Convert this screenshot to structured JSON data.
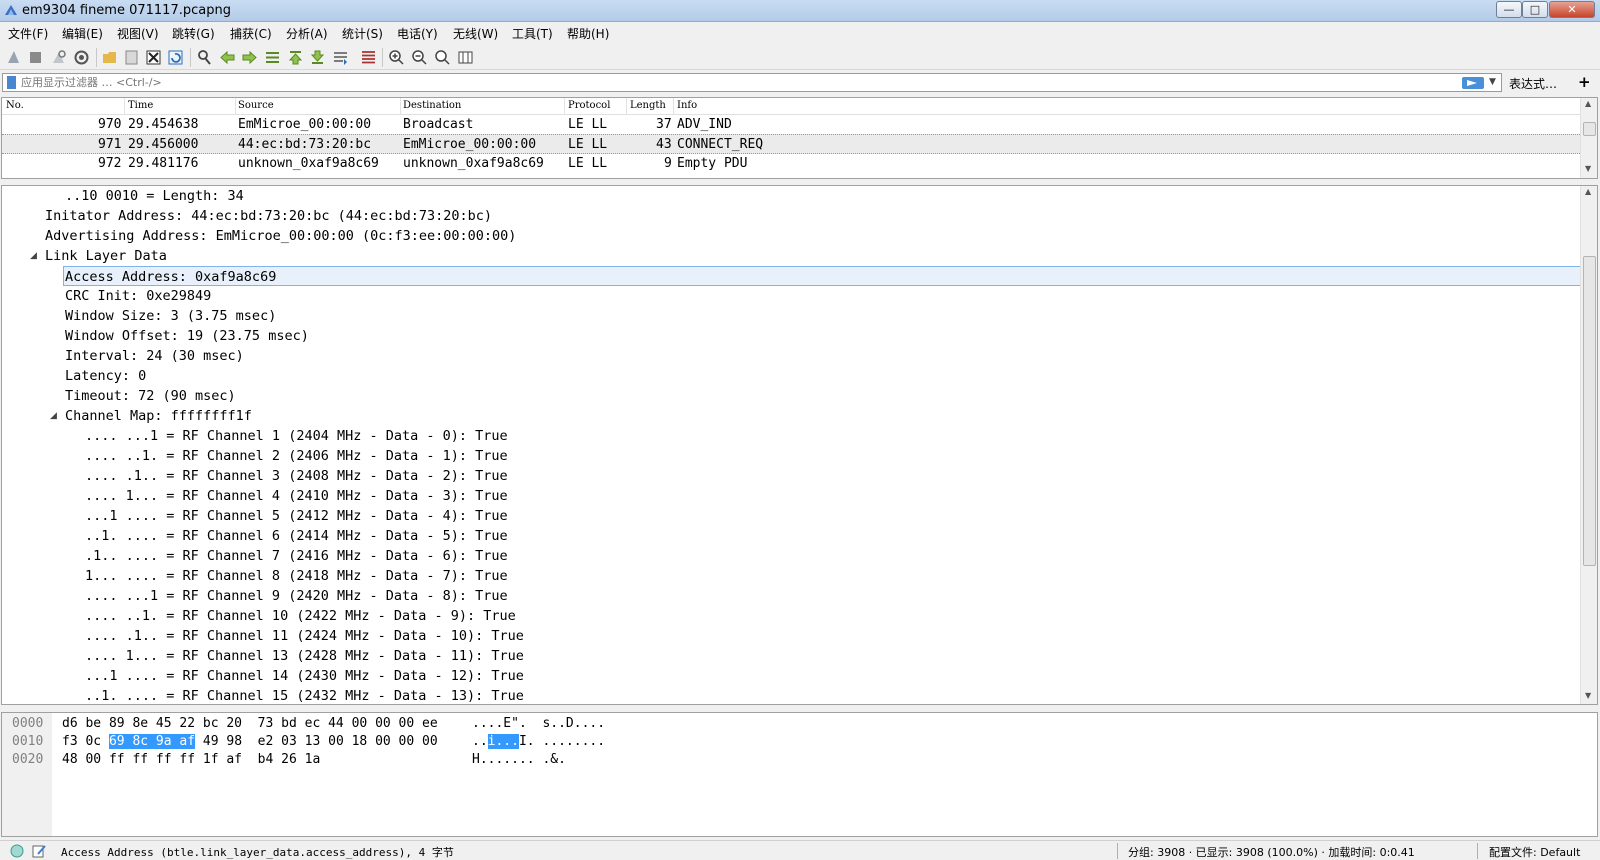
{
  "window": {
    "title": "em9304 fineme 071117.pcapng",
    "min_glyph": "—",
    "max_glyph": "□",
    "close_glyph": "✕"
  },
  "menu": [
    "文件(F)",
    "编辑(E)",
    "视图(V)",
    "跳转(G)",
    "捕获(C)",
    "分析(A)",
    "统计(S)",
    "电话(Y)",
    "无线(W)",
    "工具(T)",
    "帮助(H)"
  ],
  "filter": {
    "placeholder": "应用显示过滤器 … <Ctrl-/>",
    "dropdown_glyph": "▼",
    "expression_label": "表达式…",
    "add_label": "+"
  },
  "packet_list": {
    "columns": [
      "No.",
      "Time",
      "Source",
      "Destination",
      "Protocol",
      "Length",
      "Info"
    ],
    "rows": [
      {
        "no": "970",
        "time": "29.454638",
        "source": "EmMicroe_00:00:00",
        "destination": "Broadcast",
        "protocol": "LE LL",
        "length": "37",
        "info": "ADV_IND"
      },
      {
        "no": "971",
        "time": "29.456000",
        "source": "44:ec:bd:73:20:bc",
        "destination": "EmMicroe_00:00:00",
        "protocol": "LE LL",
        "length": "43",
        "info": "CONNECT_REQ"
      },
      {
        "no": "972",
        "time": "29.481176",
        "source": "unknown_0xaf9a8c69",
        "destination": "unknown_0xaf9a8c69",
        "protocol": "LE LL",
        "length": "9",
        "info": "Empty PDU"
      }
    ]
  },
  "details": {
    "lines": [
      "..10 0010 = Length: 34",
      "Initator Address: 44:ec:bd:73:20:bc (44:ec:bd:73:20:bc)",
      "Advertising Address: EmMicroe_00:00:00 (0c:f3:ee:00:00:00)",
      "Link Layer Data",
      "Access Address: 0xaf9a8c69",
      "CRC Init: 0xe29849",
      "Window Size: 3 (3.75 msec)",
      "Window Offset: 19 (23.75 msec)",
      "Interval: 24 (30 msec)",
      "Latency: 0",
      "Timeout: 72 (90 msec)",
      "Channel Map: ffffffff1f",
      ".... ...1 = RF Channel 1 (2404 MHz - Data - 0): True",
      ".... ..1. = RF Channel 2 (2406 MHz - Data - 1): True",
      ".... .1.. = RF Channel 3 (2408 MHz - Data - 2): True",
      ".... 1... = RF Channel 4 (2410 MHz - Data - 3): True",
      "...1 .... = RF Channel 5 (2412 MHz - Data - 4): True",
      "..1. .... = RF Channel 6 (2414 MHz - Data - 5): True",
      ".1.. .... = RF Channel 7 (2416 MHz - Data - 6): True",
      "1... .... = RF Channel 8 (2418 MHz - Data - 7): True",
      ".... ...1 = RF Channel 9 (2420 MHz - Data - 8): True",
      ".... ..1. = RF Channel 10 (2422 MHz - Data - 9): True",
      ".... .1.. = RF Channel 11 (2424 MHz - Data - 10): True",
      ".... 1... = RF Channel 13 (2428 MHz - Data - 11): True",
      "...1 .... = RF Channel 14 (2430 MHz - Data - 12): True",
      "..1. .... = RF Channel 15 (2432 MHz - Data - 13): True"
    ],
    "expand_glyph": "◢"
  },
  "bytes": {
    "offsets": [
      "0000",
      "0010",
      "0020"
    ],
    "row0": {
      "hex": "d6 be 89 8e 45 22 bc 20  73 bd ec 44 00 00 00 ee",
      "ascii": "....E\".  s..D...."
    },
    "row1": {
      "hex_pre": "f3 0c ",
      "hex_hl": "69 8c 9a af",
      "hex_post": " 49 98  e2 03 13 00 18 00 00 00",
      "ascii_pre": "..",
      "ascii_hl": "i...",
      "ascii_post": "I. ........"
    },
    "row2": {
      "hex": "48 00 ff ff ff ff 1f af  b4 26 1a",
      "ascii": "H....... .&."
    }
  },
  "status": {
    "field_info": "Access Address (btle.link_layer_data.access_address), 4 字节",
    "packets": "分组: 3908 · 已显示: 3908 (100.0%) · 加载时间: 0:0.41",
    "profile": "配置文件: Default"
  },
  "colors": {
    "selection": "#3399ff",
    "selected_tree_bg": "#e8f1fb",
    "selected_tree_border": "#7eb4ea",
    "selected_row_bg": "#ebebeb"
  }
}
